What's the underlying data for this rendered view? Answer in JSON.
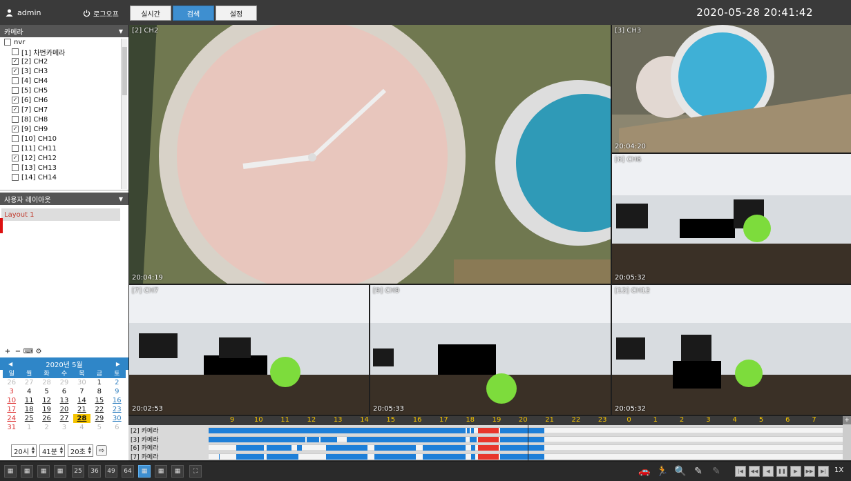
{
  "header": {
    "user": "admin",
    "logout": "로그오프",
    "tabs": [
      "실시간",
      "검색",
      "설정"
    ],
    "active_tab": 1,
    "datetime": "2020-05-28 20:41:42"
  },
  "camera_panel": {
    "title": "카메라",
    "root": "nvr",
    "items": [
      {
        "label": "[1] 차번카메라",
        "checked": false
      },
      {
        "label": "[2] CH2",
        "checked": true
      },
      {
        "label": "[3] CH3",
        "checked": true
      },
      {
        "label": "[4] CH4",
        "checked": false
      },
      {
        "label": "[5] CH5",
        "checked": false
      },
      {
        "label": "[6] CH6",
        "checked": true
      },
      {
        "label": "[7] CH7",
        "checked": true
      },
      {
        "label": "[8] CH8",
        "checked": false
      },
      {
        "label": "[9] CH9",
        "checked": true
      },
      {
        "label": "[10] CH10",
        "checked": false
      },
      {
        "label": "[11] CH11",
        "checked": false
      },
      {
        "label": "[12] CH12",
        "checked": true
      },
      {
        "label": "[13] CH13",
        "checked": false
      },
      {
        "label": "[14] CH14",
        "checked": false
      }
    ]
  },
  "layout_panel": {
    "title": "사용자 레이아웃",
    "items": [
      "Layout 1"
    ]
  },
  "calendar": {
    "month_label": "2020년 5월",
    "weekdays": [
      "일",
      "월",
      "화",
      "수",
      "목",
      "금",
      "토"
    ],
    "weeks": [
      [
        "26",
        "27",
        "28",
        "29",
        "30",
        "1",
        "2"
      ],
      [
        "3",
        "4",
        "5",
        "6",
        "7",
        "8",
        "9"
      ],
      [
        "10",
        "11",
        "12",
        "13",
        "14",
        "15",
        "16"
      ],
      [
        "17",
        "18",
        "19",
        "20",
        "21",
        "22",
        "23"
      ],
      [
        "24",
        "25",
        "26",
        "27",
        "28",
        "29",
        "30"
      ],
      [
        "31",
        "1",
        "2",
        "3",
        "4",
        "5",
        "6"
      ]
    ],
    "selected_day": "28"
  },
  "time_picker": {
    "hour": "20시",
    "minute": "41분",
    "second": "20초"
  },
  "videos": [
    {
      "label": "[2] CH2",
      "time": "20:04:19"
    },
    {
      "label": "[3] CH3",
      "time": "20:04:20"
    },
    {
      "label": "[6] CH6",
      "time": "20:05:32"
    },
    {
      "label": "[7] CH7",
      "time": "20:02:53"
    },
    {
      "label": "[9] CH9",
      "time": "20:05:33"
    },
    {
      "label": "[12] CH12",
      "time": "20:05:32"
    }
  ],
  "timeline": {
    "hours": [
      "9",
      "10",
      "11",
      "12",
      "13",
      "14",
      "15",
      "16",
      "17",
      "18",
      "19",
      "20",
      "21",
      "22",
      "23",
      "0",
      "1",
      "2",
      "3",
      "4",
      "5",
      "6",
      "7"
    ],
    "rows": [
      "[2] 카메라",
      "[3] 카메라",
      "[6] 카메라",
      "[7] 카메라"
    ],
    "colors": {
      "recording": "#1e7fd8",
      "event": "#e8372c"
    }
  },
  "bottom": {
    "layout_buttons": [
      "",
      "",
      "",
      "",
      "25",
      "36",
      "49",
      "64",
      "",
      "",
      "",
      ""
    ],
    "active_layout": 8,
    "speed": "1X"
  }
}
